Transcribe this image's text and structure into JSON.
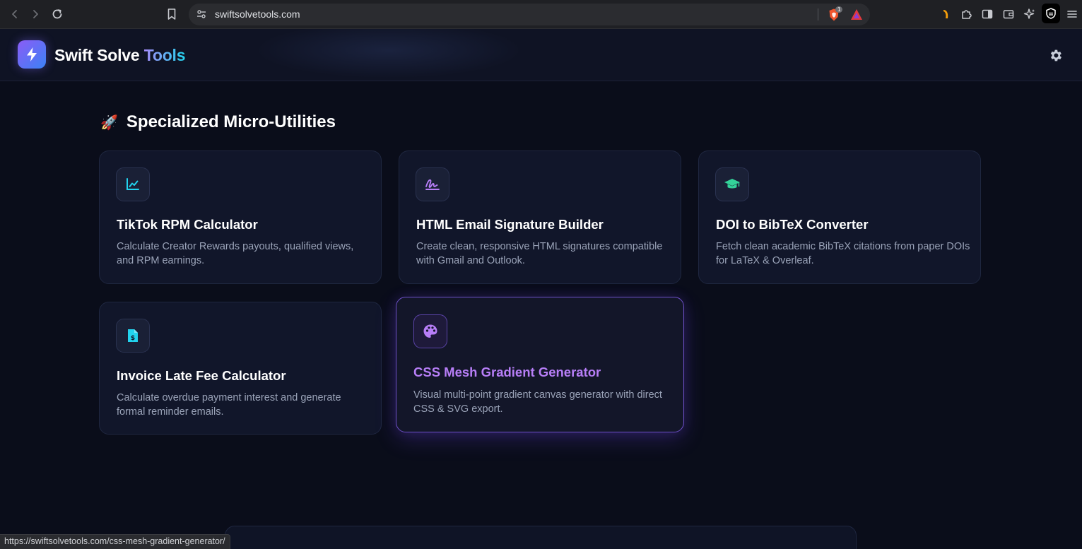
{
  "browser": {
    "url": "swiftsolvetools.com",
    "status_url": "https://swiftsolvetools.com/css-mesh-gradient-generator/",
    "shield_badge": "1"
  },
  "header": {
    "brand_main": "Swift Solve",
    "brand_accent": "Tools"
  },
  "section": {
    "title": "Specialized Micro-Utilities",
    "emoji": "🚀"
  },
  "cards": [
    {
      "title": "TikTok RPM Calculator",
      "desc": "Calculate Creator Rewards payouts, qualified views, and RPM earnings.",
      "icon": "chart-line-icon"
    },
    {
      "title": "HTML Email Signature Builder",
      "desc": "Create clean, responsive HTML signatures compatible with Gmail and Outlook.",
      "icon": "signature-icon"
    },
    {
      "title": "DOI to BibTeX Converter",
      "desc": "Fetch clean academic BibTeX citations from paper DOIs for LaTeX & Overleaf.",
      "icon": "graduation-cap-icon"
    },
    {
      "title": "Invoice Late Fee Calculator",
      "desc": "Calculate overdue payment interest and generate formal reminder emails.",
      "icon": "invoice-dollar-icon"
    },
    {
      "title": "CSS Mesh Gradient Generator",
      "desc": "Visual multi-point gradient canvas generator with direct CSS & SVG export.",
      "icon": "palette-icon"
    }
  ],
  "colors": {
    "accent_cyan": "#22d3ee",
    "accent_green": "#34d399",
    "accent_purple": "#b77ef7"
  }
}
